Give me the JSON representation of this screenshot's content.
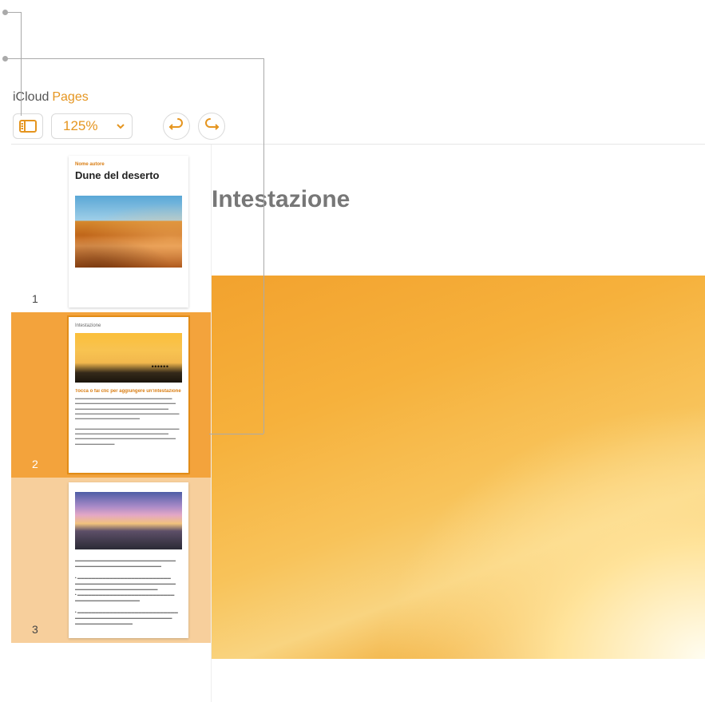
{
  "brand": {
    "icloud": "iCloud",
    "app": "Pages"
  },
  "toolbar": {
    "zoom_level": "125%"
  },
  "thumbnails": {
    "p1": {
      "number": "1",
      "author_line": "Nome autore",
      "title": "Dune del deserto"
    },
    "p2": {
      "number": "2",
      "heading": "Intestazione",
      "subheading": "Tocca o fai clic per aggiungere un'intestazione"
    },
    "p3": {
      "number": "3"
    }
  },
  "canvas": {
    "heading": "Intestazione"
  },
  "colors": {
    "accent": "#e5951f",
    "selection": "#f3a33c"
  }
}
